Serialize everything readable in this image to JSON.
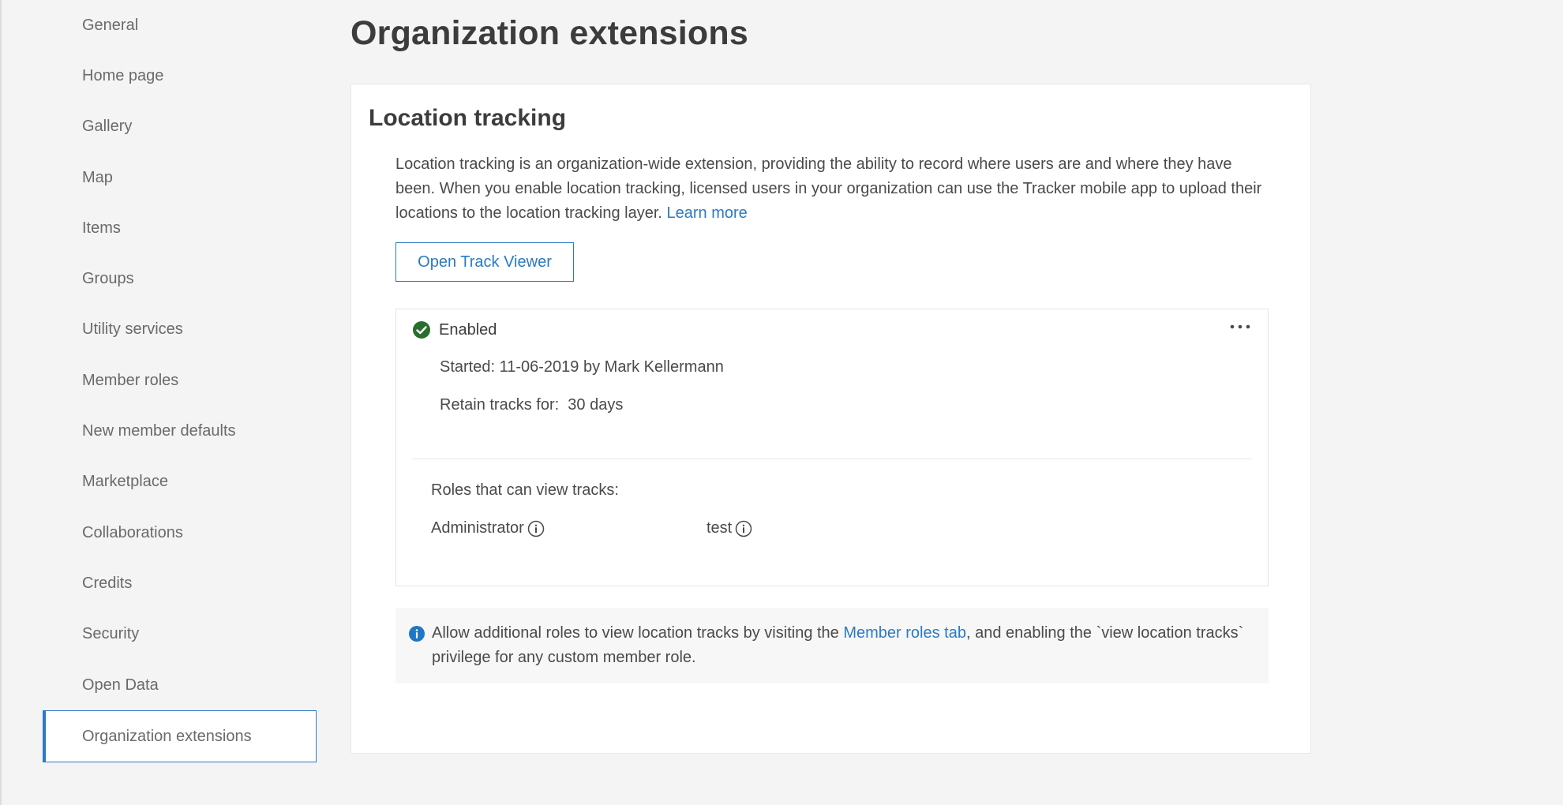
{
  "sidebar": {
    "items": [
      {
        "label": "General"
      },
      {
        "label": "Home page"
      },
      {
        "label": "Gallery"
      },
      {
        "label": "Map"
      },
      {
        "label": "Items"
      },
      {
        "label": "Groups"
      },
      {
        "label": "Utility services"
      },
      {
        "label": "Member roles"
      },
      {
        "label": "New member defaults"
      },
      {
        "label": "Marketplace"
      },
      {
        "label": "Collaborations"
      },
      {
        "label": "Credits"
      },
      {
        "label": "Security"
      },
      {
        "label": "Open Data"
      },
      {
        "label": "Organization extensions",
        "active": true
      }
    ]
  },
  "main": {
    "title": "Organization extensions",
    "card": {
      "title": "Location tracking",
      "description": "Location tracking is an organization-wide extension, providing the ability to record where users are and where they have been. When you enable location tracking, licensed users in your organization can use the Tracker mobile app to upload their locations to the location tracking layer.",
      "learn_more": "Learn more",
      "open_button": "Open Track Viewer",
      "status": {
        "label": "Enabled",
        "started": "Started: 11-06-2019 by Mark Kellermann",
        "retain": "Retain tracks for:  30 days",
        "roles_label": "Roles that can view tracks:",
        "roles": [
          "Administrator",
          "test"
        ]
      },
      "notice": {
        "text_before": "Allow additional roles to view location tracks by visiting the ",
        "link": "Member roles tab",
        "text_after": ", and enabling the `view location tracks` privilege for any custom member role."
      }
    }
  },
  "colors": {
    "accent": "#2b7ac4",
    "success": "#2a6e2f",
    "info": "#1f77c4"
  },
  "icons": {
    "status": "check-circle-icon",
    "more": "more-horizontal-icon",
    "role_info": "info-outline-icon",
    "notice": "info-filled-icon"
  }
}
